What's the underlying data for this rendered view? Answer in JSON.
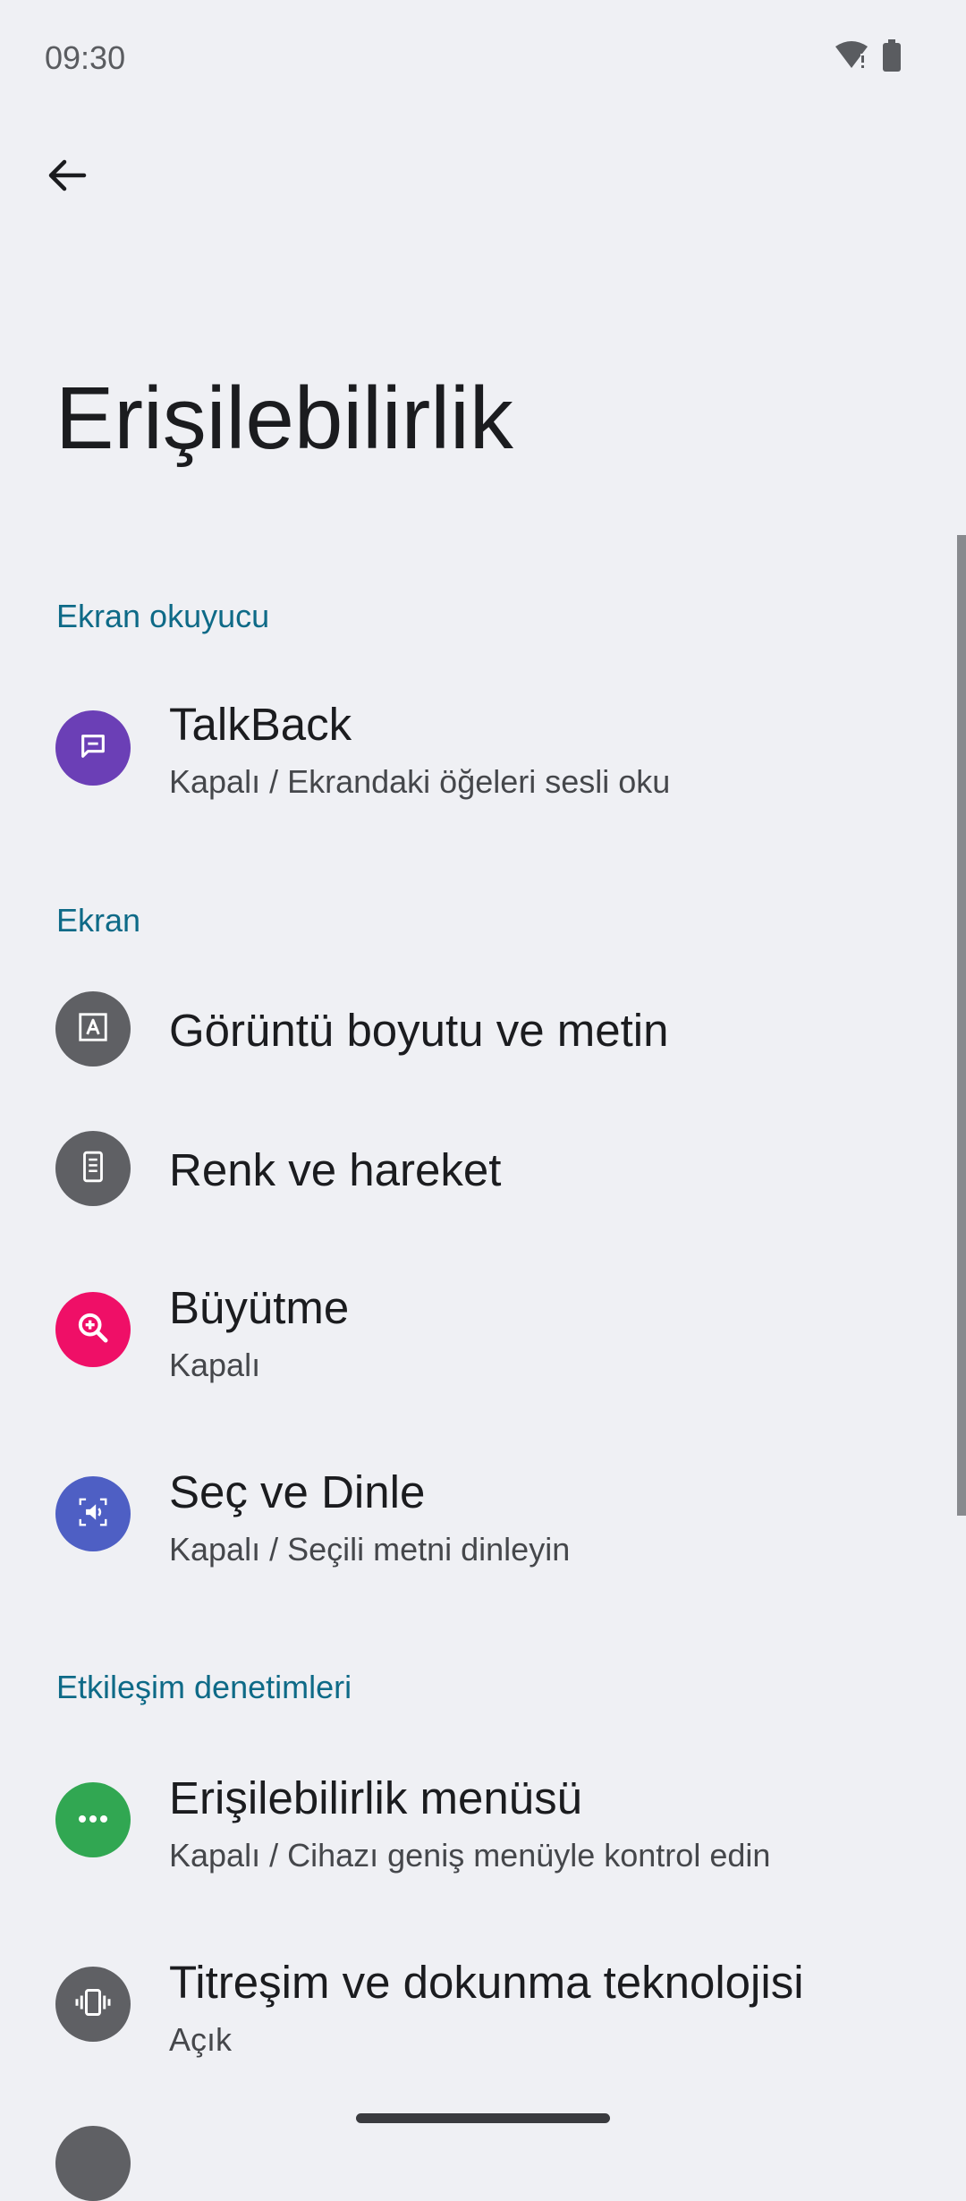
{
  "status_bar": {
    "time": "09:30",
    "wifi_icon": "wifi-alert-icon",
    "battery_icon": "battery-icon"
  },
  "header": {
    "back_icon": "arrow-back-icon",
    "title": "Erişilebilirlik"
  },
  "sections": {
    "screen_reader": {
      "header": "Ekran okuyucu",
      "talkback": {
        "title": "TalkBack",
        "subtitle": "Kapalı / Ekrandaki öğeleri sesli oku",
        "icon": "speech-bubble-icon",
        "color": "#6b3fb6"
      }
    },
    "display": {
      "header": "Ekran",
      "display_size": {
        "title": "Görüntü boyutu ve metin",
        "icon": "text-size-icon",
        "color": "#5f6064"
      },
      "color_motion": {
        "title": "Renk ve hareket",
        "icon": "phone-icon",
        "color": "#5f6064"
      },
      "magnification": {
        "title": "Büyütme",
        "subtitle": "Kapalı",
        "icon": "zoom-in-icon",
        "color": "#ef0f67"
      },
      "select_to_speak": {
        "title": "Seç ve Dinle",
        "subtitle": "Kapalı / Seçili metni dinleyin",
        "icon": "select-speak-icon",
        "color": "#4e5fc4"
      }
    },
    "interaction": {
      "header": "Etkileşim denetimleri",
      "accessibility_menu": {
        "title": "Erişilebilirlik menüsü",
        "subtitle": "Kapalı / Cihazı geniş menüyle kontrol edin",
        "icon": "more-dots-icon",
        "color": "#31a752"
      },
      "vibration": {
        "title": "Titreşim ve dokunma teknolojisi",
        "subtitle": "Açık",
        "icon": "vibration-icon",
        "color": "#5f6064"
      }
    }
  }
}
